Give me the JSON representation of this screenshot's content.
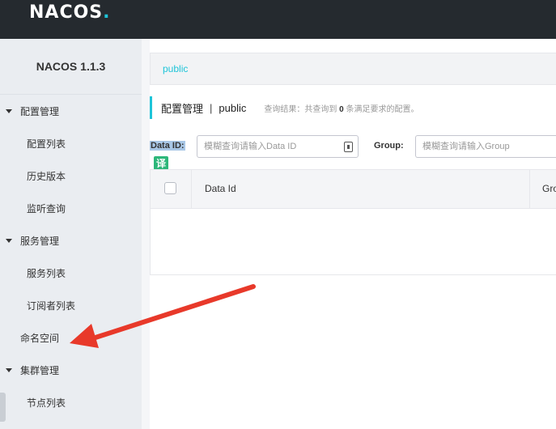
{
  "header": {
    "logo_text": "NACOS",
    "logo_dot": "."
  },
  "sidebar": {
    "version": "NACOS 1.1.3",
    "groups": [
      {
        "label": "配置管理",
        "items": [
          "配置列表",
          "历史版本",
          "监听查询"
        ]
      },
      {
        "label": "服务管理",
        "items": [
          "服务列表",
          "订阅者列表"
        ]
      }
    ],
    "namespace_item": "命名空间",
    "cluster_group": {
      "label": "集群管理",
      "items": [
        "节点列表"
      ]
    }
  },
  "main": {
    "namespace_tab": "public",
    "title": "配置管理",
    "separator": "|",
    "namespace": "public",
    "result_hint_prefix": "查询结果：共查询到",
    "result_count": "0",
    "result_hint_suffix": "条满足要求的配置。"
  },
  "search": {
    "dataid_label_highlight": "Data",
    "dataid_label_rest": " ID:",
    "dataid_placeholder": "模糊查询请输入Data ID",
    "group_label": "Group:",
    "group_placeholder": "模糊查询请输入Group"
  },
  "translate_badge": "译",
  "table": {
    "columns": [
      "Data Id",
      "Gro"
    ]
  },
  "colors": {
    "accent": "#1ec4d8",
    "topbar": "#252a2f",
    "sidebar_bg": "#eaedf1",
    "arrow": "#e8392a"
  },
  "annotation": {
    "type": "red-arrow",
    "points_to": "命名空间"
  }
}
